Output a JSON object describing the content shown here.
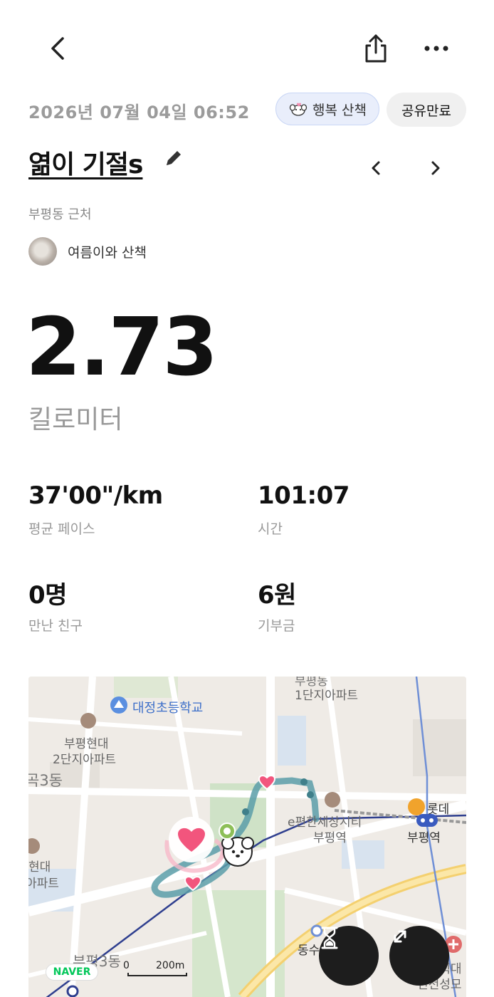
{
  "header": {
    "back_icon": "chevron-left-icon",
    "share_icon": "share-icon",
    "more_icon": "more-dots-icon"
  },
  "walk": {
    "datetime": "2026년 07월 04일 06:52",
    "badge_label": "행복 산책",
    "share_status": "공유만료",
    "title": "엶이 기절s",
    "location": "부평동 근처",
    "companion": "여름이와 산책"
  },
  "summary": {
    "distance": "2.73",
    "distance_unit": "킬로미터",
    "stats": [
      {
        "value": "37'00\"/km",
        "label": "평균 페이스"
      },
      {
        "value": "101:07",
        "label": "시간"
      },
      {
        "value": "0명",
        "label": "만난 친구"
      },
      {
        "value": "6원",
        "label": "기부금"
      }
    ]
  },
  "map": {
    "labels": {
      "school": "대정초등학교",
      "apt_top": "1단지아파트",
      "apt_top_cut": "부평동",
      "apt2_l1": "부평현대",
      "apt2_l2": "2단지아파트",
      "dong_left": "곡3동",
      "hyundai_l1": "현대",
      "hyundai_l2": "아파트",
      "city_l1": "e편한세상시티",
      "city_l2": "부평역",
      "station": "부평역",
      "lotte": "롯데",
      "dongsu": "동수역",
      "hosp_l1": "가톨릭대",
      "hosp_l2": "인천성모",
      "bupyeong3": "부평3동"
    },
    "provider": "NAVER",
    "scale_zero": "0",
    "scale_label": "200m",
    "route_color": "#5a9ea8",
    "heart_color": "#f2557d",
    "fab_timer_icon": "hourglass-icon",
    "fab_expand_icon": "expand-icon"
  }
}
